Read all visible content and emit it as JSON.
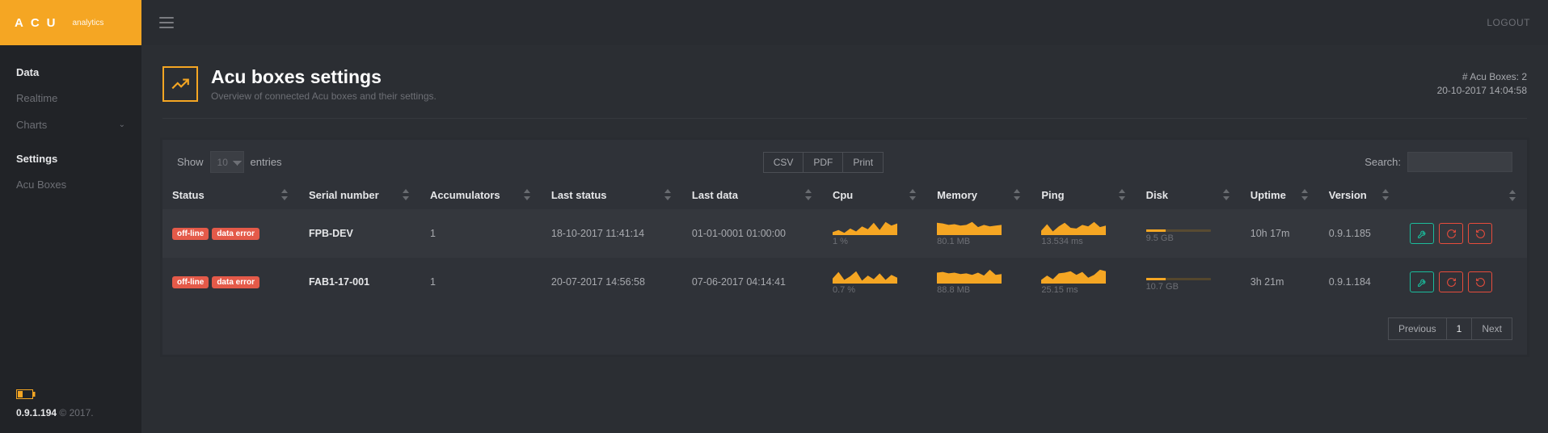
{
  "brand": {
    "logo": "ACU",
    "sub": "analytics"
  },
  "topbar": {
    "logout": "LOGOUT"
  },
  "sidebar": {
    "section1_heading": "Data",
    "items1": [
      {
        "label": "Realtime",
        "has_children": false
      },
      {
        "label": "Charts",
        "has_children": true
      }
    ],
    "section2_heading": "Settings",
    "items2": [
      {
        "label": "Acu Boxes",
        "has_children": false
      }
    ],
    "footer": {
      "version": "0.9.1.194",
      "copyright": "© 2017."
    }
  },
  "page": {
    "title": "Acu boxes settings",
    "subtitle": "Overview of connected Acu boxes and their settings.",
    "meta_count_label": "# Acu Boxes:",
    "meta_count": "2",
    "meta_time": "20-10-2017 14:04:58"
  },
  "toolbar": {
    "show_label": "Show",
    "entries_label": "entries",
    "page_size": "10",
    "export_csv": "CSV",
    "export_pdf": "PDF",
    "export_print": "Print",
    "search_label": "Search:"
  },
  "columns": [
    "Status",
    "Serial number",
    "Accumulators",
    "Last status",
    "Last data",
    "Cpu",
    "Memory",
    "Ping",
    "Disk",
    "Uptime",
    "Version",
    ""
  ],
  "rows": [
    {
      "status_badges": [
        "off-line",
        "data error"
      ],
      "serial": "FPB-DEV",
      "accumulators": "1",
      "last_status": "18-10-2017 11:41:14",
      "last_data": "01-01-0001 01:00:00",
      "cpu": "1 %",
      "memory": "80.1 MB",
      "ping": "13.534 ms",
      "disk": "9.5 GB",
      "uptime": "10h 17m",
      "version": "0.9.1.185"
    },
    {
      "status_badges": [
        "off-line",
        "data error"
      ],
      "serial": "FAB1-17-001",
      "accumulators": "1",
      "last_status": "20-07-2017 14:56:58",
      "last_data": "07-06-2017 04:14:41",
      "cpu": "0.7 %",
      "memory": "88.8 MB",
      "ping": "25.15 ms",
      "disk": "10.7 GB",
      "uptime": "3h 21m",
      "version": "0.9.1.184"
    }
  ],
  "pagination": {
    "prev": "Previous",
    "next": "Next",
    "current": "1"
  },
  "chart_data": {
    "type": "sparkline-area",
    "note": "miniature sparkline areas per row for cpu/memory/ping; values are relative 0-1 approximations",
    "series": {
      "row0": {
        "cpu": [
          0.2,
          0.35,
          0.15,
          0.45,
          0.25,
          0.6,
          0.4,
          0.85,
          0.35,
          0.9,
          0.65,
          0.8
        ],
        "memory": [
          0.85,
          0.8,
          0.7,
          0.75,
          0.65,
          0.7,
          0.9,
          0.55,
          0.7,
          0.6,
          0.65,
          0.7
        ],
        "ping": [
          0.3,
          0.75,
          0.25,
          0.6,
          0.85,
          0.5,
          0.45,
          0.7,
          0.6,
          0.9,
          0.55,
          0.65
        ]
      },
      "row1": {
        "cpu": [
          0.35,
          0.8,
          0.25,
          0.5,
          0.85,
          0.2,
          0.55,
          0.3,
          0.7,
          0.25,
          0.6,
          0.4
        ],
        "memory": [
          0.75,
          0.8,
          0.7,
          0.75,
          0.65,
          0.7,
          0.6,
          0.75,
          0.55,
          0.95,
          0.6,
          0.65
        ],
        "ping": [
          0.25,
          0.55,
          0.3,
          0.7,
          0.75,
          0.85,
          0.6,
          0.8,
          0.4,
          0.6,
          0.95,
          0.85
        ]
      }
    }
  }
}
